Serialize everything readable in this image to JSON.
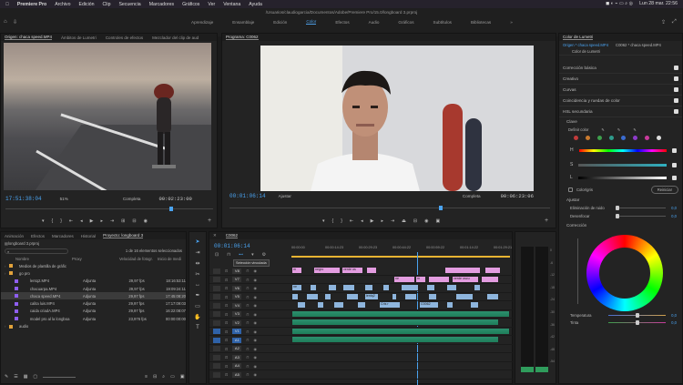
{
  "menubar": {
    "apple": "",
    "app": "Premiere Pro",
    "items": [
      "Archivo",
      "Edición",
      "Clip",
      "Secuencia",
      "Marcadores",
      "Gráficos",
      "Ver",
      "Ventana",
      "Ayuda"
    ],
    "datetime": "Lun 28 mar.  22:56"
  },
  "path": "/Usuarios/claudiogarcia/Documentos/Adobe/Premiere Pro/15.0/longboard 3.prproj",
  "workspaces": [
    "Aprendizaje",
    "Ensamblaje",
    "Edición",
    "Color",
    "Efectos",
    "Audio",
    "Gráficos",
    "Subtítulos",
    "Bibliotecas"
  ],
  "workspace_more": "»",
  "source": {
    "tabs": [
      "Origen: chaca speed.MP4",
      "Ámbitos de Lumetri",
      "Controles de efectos",
      "Mezclador del clip de aud"
    ],
    "timecode": "17:51:38:04",
    "zoom": "51%",
    "quality": "Completa",
    "duration": "00:02:23:00"
  },
  "program": {
    "tab": "Programa: C0062",
    "timecode": "00:01:06:14",
    "fit": "Ajustar",
    "quality": "Completa",
    "duration": "00:06:23:06"
  },
  "lumetri": {
    "tab": "Color de Lumetri",
    "source": "Origen * chaca speed.MP4",
    "seq": "C0062 * chaca speed.MP4",
    "preset": "Color de Lumetri",
    "sections": [
      "Corrección básica",
      "Creativo",
      "Curvas",
      "Coincidencia y ruedas de color",
      "HSL secundaria"
    ],
    "clave": "Clave",
    "definir": "Definir color",
    "h": "H",
    "s": "S",
    "l": "L",
    "color_gray": "Color/gris",
    "reiniciar": "Reiniciar",
    "ajustar": "Ajustar",
    "eliminar_ruido": "Eliminación de ruido",
    "eliminar_val": "0,0",
    "desenfocar": "Desenfocar",
    "desenfocar_val": "0,0",
    "correccion": "Corrección",
    "temperatura": "Temperatura",
    "temperatura_val": "0,0",
    "tinta": "Tinta",
    "tinta_val": "0,0"
  },
  "project": {
    "tabs": [
      "Animación",
      "Efectos",
      "Marcadores",
      "Historial",
      "Proyecto: longboard 3"
    ],
    "name": "longboard 3.prproj",
    "selected": "1 de 16 elementos seleccionados",
    "headers": [
      "Nombre",
      "Proxy",
      "Velocidad de fotogr.",
      "Inicio de medi"
    ],
    "rows": [
      {
        "name": "Medios de plantilla de gráfic",
        "proxy": "",
        "fps": "",
        "start": "",
        "color": "#e2a23b",
        "folder": true
      },
      {
        "name": "go pro",
        "proxy": "",
        "fps": "",
        "start": "",
        "color": "#e2a23b",
        "folder": true
      },
      {
        "name": "lentq2.MP4",
        "proxy": "Adjunta",
        "fps": "29,97 fps",
        "start": "18:16:53:11",
        "color": "#8e5ef0"
      },
      {
        "name": "chacuarpa.MP4",
        "proxy": "Adjunta",
        "fps": "29,97 fps",
        "start": "19:09:24:11",
        "color": "#8e5ef0"
      },
      {
        "name": "chaca speed.MP4",
        "proxy": "Adjunta",
        "fps": "29,97 fps",
        "start": "17:45:08:20",
        "color": "#8e5ef0"
      },
      {
        "name": "calita luis.MP4",
        "proxy": "Adjunta",
        "fps": "29,97 fps",
        "start": "17:17:09:03",
        "color": "#8e5ef0"
      },
      {
        "name": "caida criadA.MP4",
        "proxy": "Adjunta",
        "fps": "29,97 fps",
        "start": "16:22:08:07",
        "color": "#8e5ef0"
      },
      {
        "name": "model pro al la longboa",
        "proxy": "Adjunta",
        "fps": "23,976 fps",
        "start": "00:00:00:00",
        "color": "#8e5ef0"
      },
      {
        "name": "audio",
        "proxy": "",
        "fps": "",
        "start": "",
        "color": "#e2a23b",
        "folder": true
      }
    ]
  },
  "timeline": {
    "tab": "C0062",
    "timecode": "00:01:06:14",
    "tooltip": "Selección vinculada",
    "ruler": [
      "00:00:00",
      "00:00:14:23",
      "00:00:29:23",
      "00:00:44:22",
      "00:00:59:22",
      "00:01:14:22",
      "00:01:29:21"
    ],
    "tracks": [
      "V8",
      "V7",
      "V6",
      "V5",
      "V4",
      "V3",
      "V2",
      "V1",
      "A1",
      "A2",
      "A3",
      "A4",
      "A5"
    ],
    "clips_v8": [
      "m",
      "negro",
      "verde os"
    ],
    "clips_v7": [
      "ne",
      "m",
      "verde oscu"
    ],
    "clips_v6": [
      "ne"
    ],
    "clip_v5": "lentq2",
    "clip_v4": [
      "Cris r",
      "C0062"
    ]
  },
  "meter": [
    "0",
    "-6",
    "-12",
    "-18",
    "-24",
    "-30",
    "-36",
    "-42",
    "-48",
    "-54"
  ]
}
